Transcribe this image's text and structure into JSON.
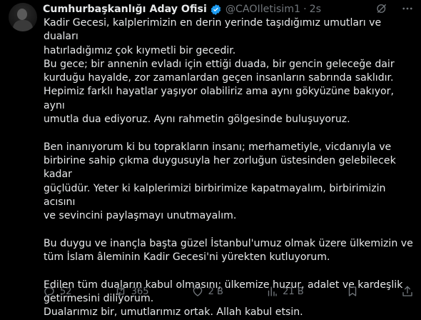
{
  "author": {
    "name": "Cumhurbaşkanlığı Aday Ofisi",
    "handle": "@CAOIletisim1",
    "time": "2s"
  },
  "body": {
    "paragraphs": [
      "Kadir Gecesi, kalplerimizin en derin yerinde taşıdığımız umutları ve duaları\nhatırladığımız çok kıymetli bir gecedir.\nBu gece; bir annenin evladı için ettiği duada, bir gencin geleceğe dair\nkurduğu hayalde, zor zamanlardan geçen insanların sabrında saklıdır.\nHepimiz farklı hayatlar yaşıyor olabiliriz ama aynı gökyüzüne bakıyor, aynı\numutla dua ediyoruz. Aynı rahmetin gölgesinde buluşuyoruz.",
      "Ben inanıyorum ki bu toprakların insanı; merhametiyle, vicdanıyla ve\nbirbirine sahip çıkma duygusuyla her zorluğun üstesinden gelebilecek kadar\ngüçlüdür. Yeter ki kalplerimizi birbirimize kapatmayalım, birbirimizin acısını\nve sevincini paylaşmayı unutmayalım.",
      "Bu duygu ve inançla başta güzel İstanbul'umuz olmak üzere ülkemizin ve\ntüm İslam âleminin Kadir Gecesi'ni yürekten kutluyorum.",
      "Edilen tüm duaların kabul olmasını; ülkemize huzur, adalet ve kardeşlik\ngetirmesini diliyorum.\nDualarımız bir, umutlarımız ortak. Allah kabul etsin."
    ]
  },
  "actions": {
    "replies": "52",
    "reposts": "365",
    "likes": "2 B",
    "views": "21 B"
  },
  "colors": {
    "background": "#000000",
    "text": "#e7e9ea",
    "muted": "#71767b",
    "verified": "#1d9bf0"
  }
}
